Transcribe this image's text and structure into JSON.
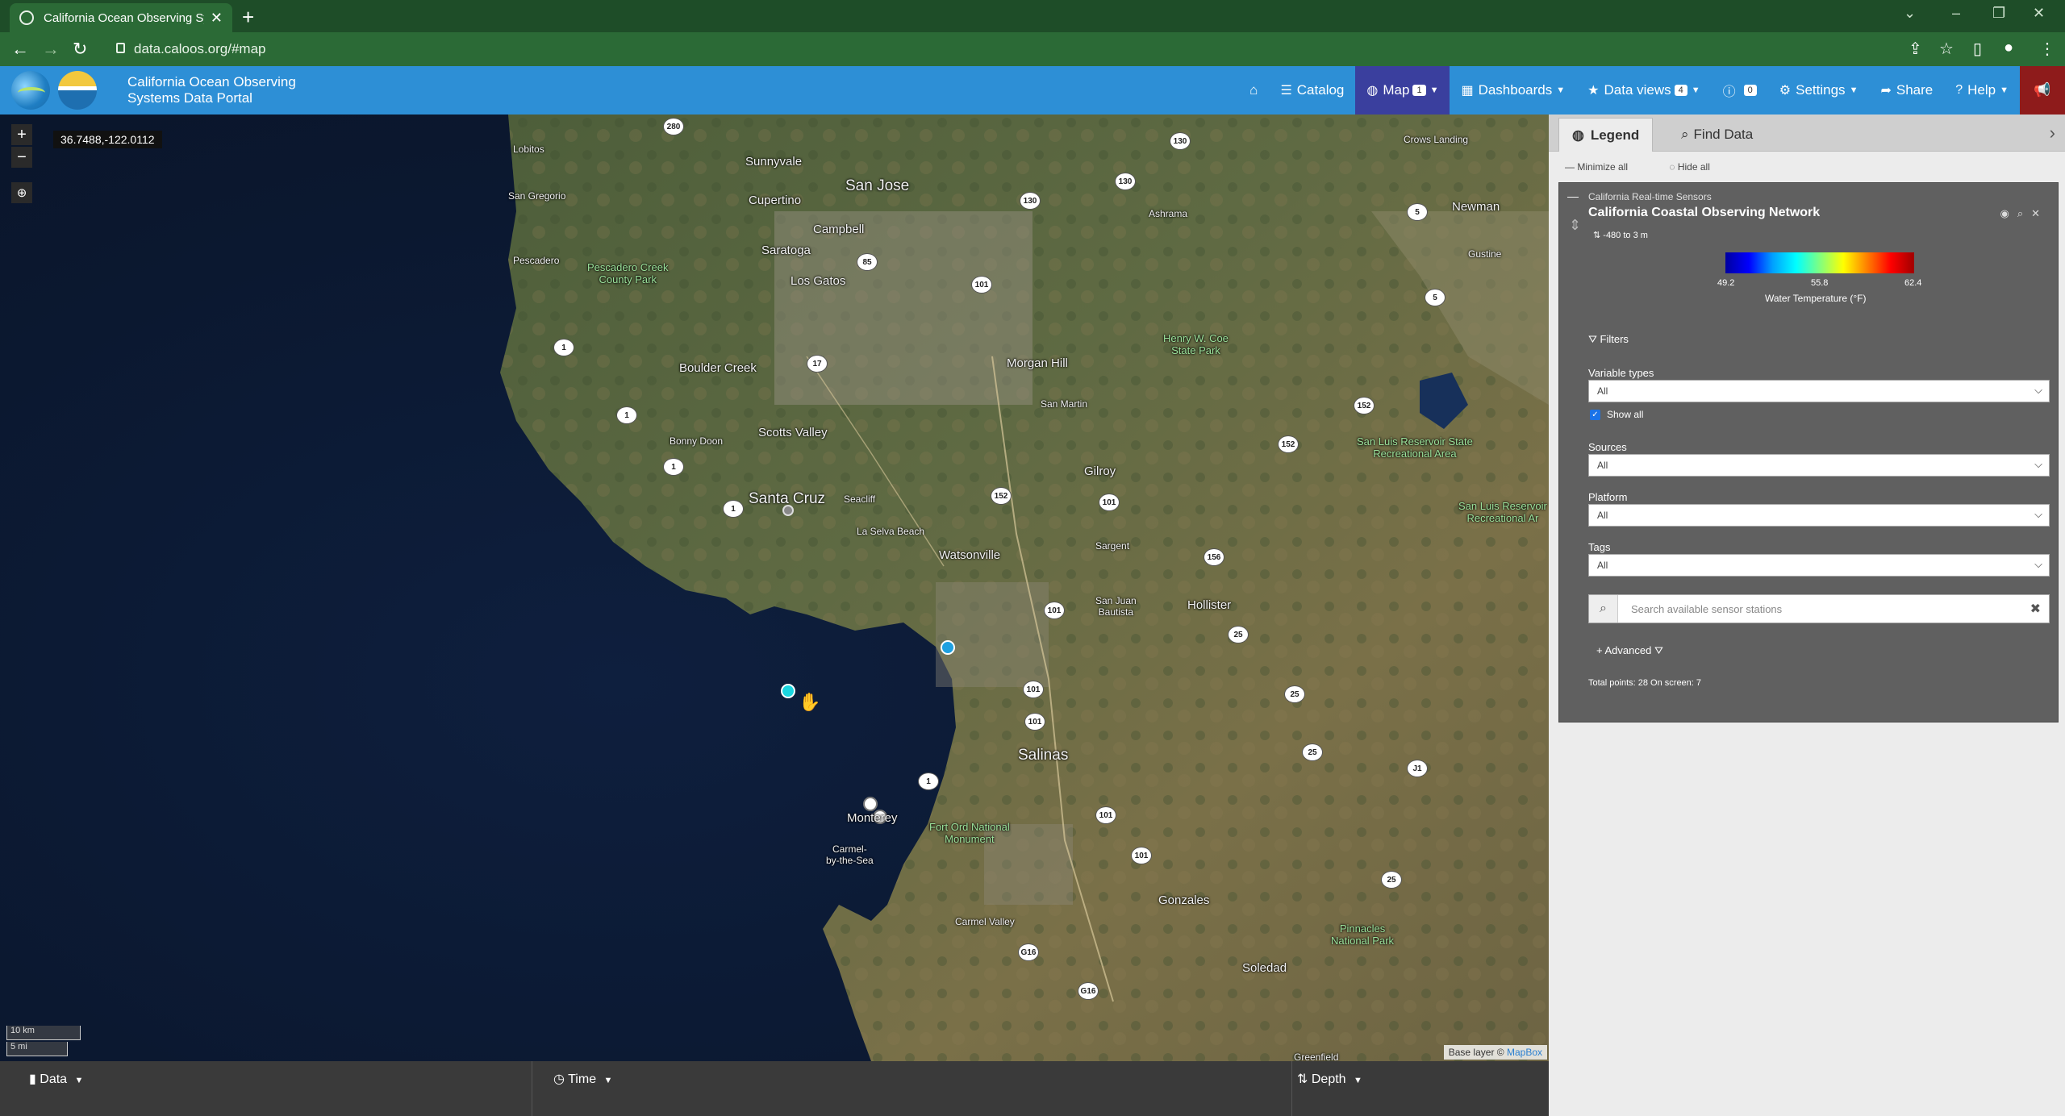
{
  "browser": {
    "tab_title": "California Ocean Observing Syst…",
    "url": "data.caloos.org/#map"
  },
  "app": {
    "brand_line1": "California Ocean Observing",
    "brand_line2": "Systems Data Portal",
    "nav": {
      "catalog": "Catalog",
      "map": "Map",
      "map_badge": "1",
      "dashboards": "Dashboards",
      "data_views": "Data views",
      "data_views_badge": "4",
      "alerts_badge": "0",
      "settings": "Settings",
      "share": "Share",
      "help": "Help"
    }
  },
  "map": {
    "coordinates": "36.7488,-122.0112",
    "scale_km": "10 km",
    "scale_mi": "5 mi",
    "attribution_prefix": "Base layer © ",
    "attribution_link": "MapBox",
    "labels": {
      "sunnyvale": "Sunnyvale",
      "san_jose": "San Jose",
      "cupertino": "Cupertino",
      "campbell": "Campbell",
      "saratoga": "Saratoga",
      "los_gatos": "Los Gatos",
      "lobitos": "Lobitos",
      "san_gregorio": "San Gregorio",
      "pescadero": "Pescadero",
      "pescadero_park": "Pescadero Creek\nCounty Park",
      "boulder_creek": "Boulder Creek",
      "bonny_doon": "Bonny Doon",
      "scotts_valley": "Scotts Valley",
      "santa_cruz": "Santa Cruz",
      "seacliff": "Seacliff",
      "la_selva_beach": "La Selva Beach",
      "watsonville": "Watsonville",
      "morgan_hill": "Morgan Hill",
      "san_martin": "San Martin",
      "gilroy": "Gilroy",
      "sargent": "Sargent",
      "san_juan_bautista": "San Juan\nBautista",
      "hollister": "Hollister",
      "salinas": "Salinas",
      "monterey": "Monterey",
      "carmel": "Carmel-\nby-the-Sea",
      "carmel_valley": "Carmel Valley",
      "fort_ord": "Fort Ord National\nMonument",
      "gonzales": "Gonzales",
      "soledad": "Soledad",
      "greenfield": "Greenfield",
      "pinnacles": "Pinnacles\nNational Park",
      "henry_coe": "Henry W. Coe\nState Park",
      "ashrama": "Ashrama",
      "newman": "Newman",
      "gustine": "Gustine",
      "crows_landing": "Crows Landing",
      "san_luis_reservoir": "San Luis Reservoir State\nRecreational Area",
      "san_luis_reservoir_2": "San Luis Reservoir\nRecreational Ar"
    },
    "shields": [
      "280",
      "85",
      "101",
      "130",
      "130",
      "130",
      "17",
      "1",
      "1",
      "1",
      "1",
      "152",
      "152",
      "101",
      "101",
      "101",
      "101",
      "156",
      "25",
      "25",
      "25",
      "25",
      "J1",
      "101",
      "101",
      "1",
      "G16",
      "G16",
      "152",
      "5",
      "5"
    ]
  },
  "bottombar": {
    "data": "Data",
    "time": "Time",
    "depth": "Depth"
  },
  "panel": {
    "tab_legend": "Legend",
    "tab_find": "Find Data",
    "minimize_all": "Minimize all",
    "hide_all": "Hide all",
    "layer_group": "California Real-time Sensors",
    "layer_title": "California Coastal Observing Network",
    "depth_range": "-480 to 3 m",
    "colorbar_min": "49.2",
    "colorbar_mid": "55.8",
    "colorbar_max": "62.4",
    "colorbar_title": "Water Temperature (°F)",
    "filters": "Filters",
    "variable_types": "Variable types",
    "variable_types_value": "All",
    "show_all": "Show all",
    "sources": "Sources",
    "sources_value": "All",
    "platform": "Platform",
    "platform_value": "All",
    "tags": "Tags",
    "tags_value": "All",
    "search_placeholder": "Search available sensor stations",
    "advanced": "Advanced",
    "total_points": "Total points: 28 On screen: 7"
  },
  "colors": {
    "chrome": "#1e4d28",
    "appbar": "#2d8fd6",
    "active_nav": "#3a3f9e",
    "sensor_cyan": "#1ad6e0",
    "sensor_blue": "#1fa0e0"
  }
}
